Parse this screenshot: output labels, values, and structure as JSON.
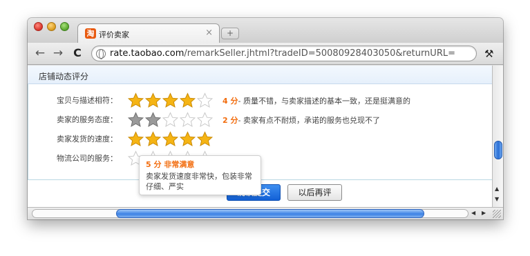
{
  "browser": {
    "tab_title": "评价卖家",
    "tab_favicon_text": "淘",
    "tab_close": "×",
    "new_tab": "+",
    "url_host": "rate.taobao.com",
    "url_path": "/remarkSeller.jhtml?tradeID=50080928403050&returnURL=...",
    "back": "←",
    "forward": "→",
    "reload": "C",
    "bookmark_star": "☆",
    "wrench": "🔧"
  },
  "section": {
    "title": "店铺动态评分"
  },
  "ratings": [
    {
      "label": "宝贝与描述相符：",
      "stars": 4,
      "star_style": "gold",
      "score_num": "4 分",
      "score_text": "- 质量不错，与卖家描述的基本一致，还是挺满意的"
    },
    {
      "label": "卖家的服务态度：",
      "stars": 2,
      "star_style": "gray",
      "score_num": "2 分",
      "score_text": "- 卖家有点不耐烦，承诺的服务也兑现不了"
    },
    {
      "label": "卖家发货的速度：",
      "stars": 5,
      "star_style": "gold",
      "score_num": "",
      "score_text": ""
    },
    {
      "label": "物流公司的服务：",
      "stars": 0,
      "star_style": "gold",
      "score_num": "",
      "score_text": ""
    }
  ],
  "tooltip": {
    "head": "5 分  非常满意",
    "body": "卖家发货速度非常快，包装非常仔细、严实"
  },
  "actions": {
    "submit_label": "确认提交",
    "later_label": "以后再评"
  },
  "colors": {
    "accent_orange": "#f26c0d",
    "star_gold": "#f5b414",
    "star_gray": "#9a9a9a",
    "submit_blue": "#1a6ee0"
  }
}
